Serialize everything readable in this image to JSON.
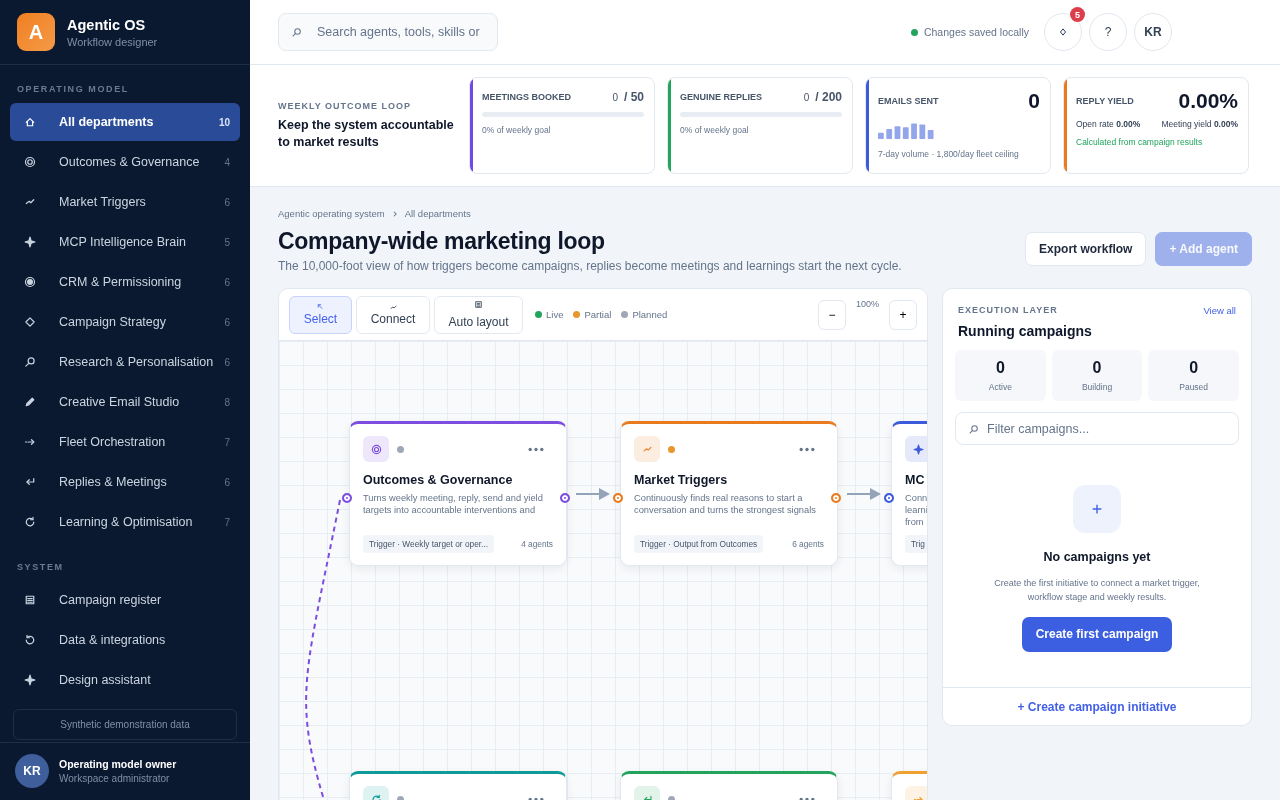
{
  "brand": {
    "logo_letter": "A",
    "name": "Agentic OS",
    "subtitle": "Workflow designer"
  },
  "sidebar": {
    "sections": [
      {
        "title": "OPERATING MODEL",
        "items": [
          {
            "label": "All departments",
            "count": "10",
            "kind": "home",
            "selected": true
          },
          {
            "label": "Outcomes & Governance",
            "count": "4",
            "kind": "target",
            "selected": false
          },
          {
            "label": "Market Triggers",
            "count": "6",
            "kind": "bolt",
            "selected": false
          },
          {
            "label": "MCP Intelligence Brain",
            "count": "5",
            "kind": "sparkle",
            "selected": false
          },
          {
            "label": "CRM & Permissioning",
            "count": "6",
            "kind": "record",
            "selected": false
          },
          {
            "label": "Campaign Strategy",
            "count": "6",
            "kind": "diamond",
            "selected": false
          },
          {
            "label": "Research & Personalisation",
            "count": "6",
            "kind": "search",
            "selected": false
          },
          {
            "label": "Creative Email Studio",
            "count": "8",
            "kind": "pencil",
            "selected": false
          },
          {
            "label": "Fleet Orchestration",
            "count": "7",
            "kind": "arrow",
            "selected": false
          },
          {
            "label": "Replies & Meetings",
            "count": "6",
            "kind": "reply",
            "selected": false
          },
          {
            "label": "Learning & Optimisation",
            "count": "7",
            "kind": "refresh",
            "selected": false
          }
        ]
      },
      {
        "title": "SYSTEM",
        "items": [
          {
            "label": "Campaign register",
            "kind": "list",
            "selected": false
          },
          {
            "label": "Data & integrations",
            "kind": "history",
            "selected": false
          },
          {
            "label": "Design assistant",
            "kind": "sparkle",
            "selected": false
          }
        ]
      }
    ],
    "notice": "Synthetic demonstration data",
    "user": {
      "initials": "KR",
      "name": "Operating model owner",
      "role": "Workspace administrator"
    }
  },
  "topbar": {
    "search": {
      "placeholder": "Search agents, tools, skills or"
    },
    "save_status": "Changes saved locally",
    "notification_badge": "5",
    "help": "?",
    "avatar": "KR"
  },
  "outcome_loop": {
    "eyebrow": "WEEKLY OUTCOME LOOP",
    "title": "Keep the system accountable to market results",
    "kpis": [
      {
        "kind": "goal",
        "label": "MEETINGS BOOKED",
        "value": "0",
        "target": "/ 50",
        "level": 0,
        "note": "0% of weekly goal",
        "color": "#7048e8"
      },
      {
        "kind": "goal",
        "label": "GENUINE REPLIES",
        "value": "0",
        "target": "/ 200",
        "level": 0,
        "note": "0% of weekly goal",
        "color": "#22a45d"
      },
      {
        "kind": "volume",
        "label": "EMAILS SENT",
        "value": "0",
        "note": "7-day volume · 1,800/day fleet ceiling",
        "color": "#3b5bdb"
      },
      {
        "kind": "yield",
        "label": "REPLY YIELD",
        "value": "0.00%",
        "metrics": [
          {
            "label": "Open rate",
            "value": "0.00%"
          },
          {
            "label": "Meeting yield",
            "value": "0.00%"
          }
        ],
        "note": "Calculated from campaign results",
        "color": "#ea7a1e"
      }
    ]
  },
  "page": {
    "breadcrumb": [
      "Agentic operating system",
      "All departments"
    ],
    "title": "Company-wide marketing loop",
    "subtitle": "The 10,000-foot view of how triggers become campaigns, replies become meetings and learnings start the next cycle.",
    "actions": [
      {
        "label": "Export workflow",
        "kind": "secondary",
        "disabled": false
      },
      {
        "label": "+ Add agent",
        "kind": "primary",
        "disabled": true
      }
    ]
  },
  "canvas": {
    "tools": [
      {
        "label": "Select",
        "kind": "cursor",
        "selected": true
      },
      {
        "label": "Connect",
        "kind": "bolt",
        "selected": false
      },
      {
        "label": "Auto layout",
        "kind": "list",
        "selected": false
      }
    ],
    "legend": [
      {
        "label": "Live",
        "color": "#22a45d"
      },
      {
        "label": "Partial",
        "color": "#e8962e"
      },
      {
        "label": "Planned",
        "color": "#a0a8b8"
      }
    ],
    "zoom": {
      "out_button": "−",
      "value": "100%",
      "in_button": "+"
    },
    "nodes": [
      {
        "kind": "target",
        "color": "#7c4ddf",
        "partial": false,
        "arrow_out": true,
        "dashed_link": true,
        "title": "Outcomes & Governance",
        "description": "Turns weekly meeting, reply, send and yield\ntargets into accountable interventions and",
        "trigger": "Trigger · Weekly target or oper...",
        "agents": "4 agents"
      },
      {
        "kind": "bolt",
        "color": "#ea7a1e",
        "partial": true,
        "arrow_out": true,
        "title": "Market Triggers",
        "description": "Continuously finds real reasons to start a\nconversation and turns the strongest signals",
        "trigger": "Trigger · Output from Outcomes",
        "agents": "6 agents"
      },
      {
        "kind": "sparkle",
        "color": "#3b5bdb",
        "title": "MC",
        "description": "Conn\nlearni\nfrom",
        "trigger": "Trig"
      },
      {
        "kind": "refresh",
        "color": "#0f9a9a",
        "partial": false
      },
      {
        "kind": "reply",
        "color": "#22a45d",
        "partial": false
      },
      {
        "kind": "arrow",
        "color": "#f0a030"
      }
    ]
  },
  "execution": {
    "eyebrow": "EXECUTION LAYER",
    "link": "View all",
    "title": "Running campaigns",
    "stats": [
      {
        "value": "0",
        "label": "Active"
      },
      {
        "value": "0",
        "label": "Building"
      },
      {
        "value": "0",
        "label": "Paused"
      }
    ],
    "filter": {
      "placeholder": "Filter campaigns..."
    },
    "empty": {
      "title": "No campaigns yet",
      "text": "Create the first initiative to connect a market trigger, workflow stage and weekly results.",
      "button": "Create first campaign"
    },
    "footer_link": "+ Create campaign initiative"
  }
}
